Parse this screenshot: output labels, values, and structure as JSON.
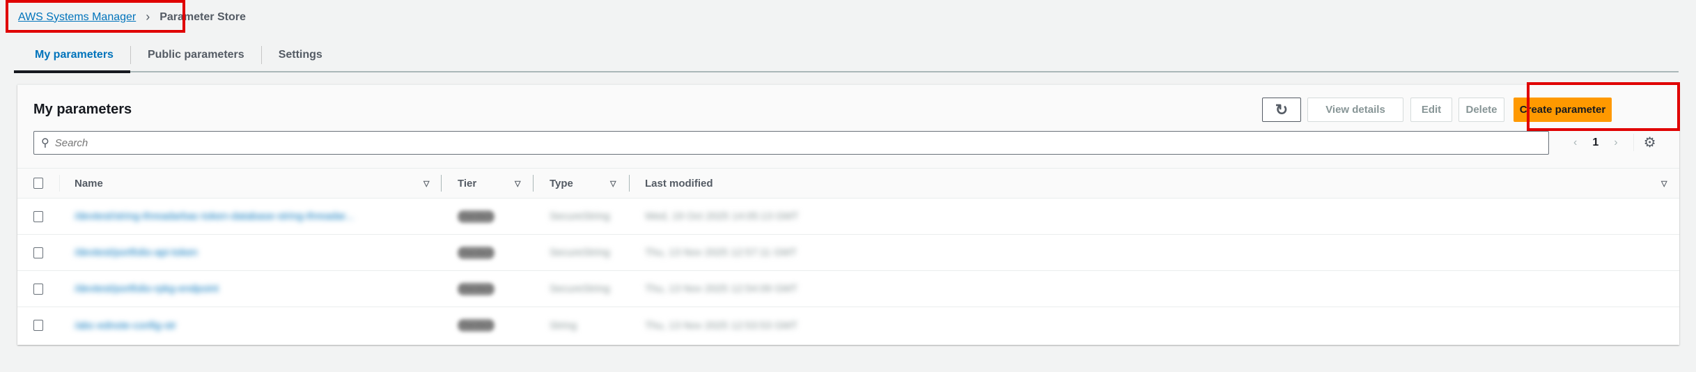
{
  "breadcrumb": {
    "parent": "AWS Systems Manager",
    "current": "Parameter Store"
  },
  "tabs": [
    {
      "label": "My parameters"
    },
    {
      "label": "Public parameters"
    },
    {
      "label": "Settings"
    }
  ],
  "panel": {
    "title": "My parameters",
    "buttons": {
      "view_details": "View details",
      "edit": "Edit",
      "delete": "Delete",
      "create": "Create parameter"
    },
    "search_placeholder": "Search",
    "page": "1"
  },
  "table": {
    "columns": [
      "Name",
      "Tier",
      "Type",
      "Last modified"
    ],
    "rows": [
      {
        "name": "/devtest/string-threadarbac-token-database-string-threadar...",
        "tier": "Standard",
        "type": "SecureString",
        "modified": "Wed, 19 Oct 2025 14:05:13 GMT"
      },
      {
        "name": "/devtest/portfolio-api-token",
        "tier": "Standard",
        "type": "SecureString",
        "modified": "Thu, 13 Nov 2025 12:57:11 GMT"
      },
      {
        "name": "/devtest/portfolio-rpkg-endpoint",
        "tier": "Standard",
        "type": "SecureString",
        "modified": "Thu, 13 Nov 2025 12:54:09 GMT"
      },
      {
        "name": "/abc-ednote-config-str",
        "tier": "Standard",
        "type": "String",
        "modified": "Thu, 13 Nov 2025 12:53:53 GMT"
      }
    ]
  },
  "colors": {
    "accent": "#0073bb",
    "primary_button": "#ff9900",
    "highlight": "#e00000"
  }
}
